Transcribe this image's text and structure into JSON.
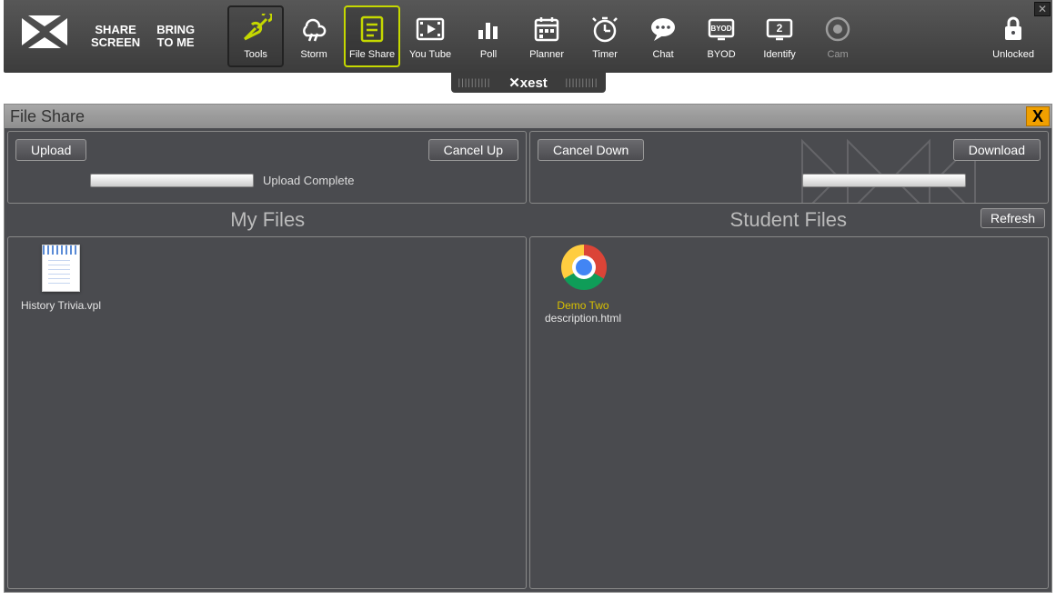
{
  "toolbar": {
    "share_screen": "SHARE\nSCREEN",
    "bring_to_me": "BRING\nTO ME",
    "items": [
      {
        "label": "Tools"
      },
      {
        "label": "Storm"
      },
      {
        "label": "File Share"
      },
      {
        "label": "You Tube"
      },
      {
        "label": "Poll"
      },
      {
        "label": "Planner"
      },
      {
        "label": "Timer"
      },
      {
        "label": "Chat"
      },
      {
        "label": "BYOD"
      },
      {
        "label": "Identify"
      },
      {
        "label": "Cam"
      }
    ],
    "lock_label": "Unlocked",
    "brand": "xest"
  },
  "file_share": {
    "title": "File Share",
    "close": "X",
    "upload_btn": "Upload",
    "cancel_up_btn": "Cancel Up",
    "cancel_down_btn": "Cancel Down",
    "download_btn": "Download",
    "refresh_btn": "Refresh",
    "upload_status": "Upload Complete",
    "my_files_label": "My Files",
    "student_files_label": "Student Files",
    "my_files": [
      {
        "name": "History Trivia.vpl"
      }
    ],
    "student_files": [
      {
        "student": "Demo Two",
        "name": "description.html"
      }
    ]
  }
}
